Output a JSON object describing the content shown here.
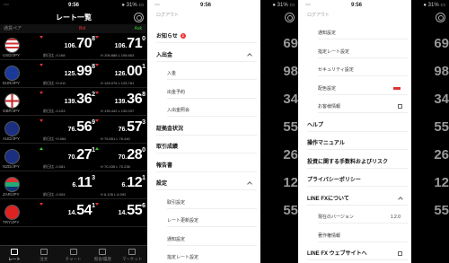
{
  "status": {
    "carrier": "⋯",
    "time": "9:56",
    "right": "● 31% ▭"
  },
  "list_screen": {
    "title": "レート一覧",
    "col_pair": "通貨ペア",
    "col_bid": "Bid",
    "col_ask": "Ask",
    "rows": [
      {
        "pair": "USD/JPY",
        "bid_prefix": "106.",
        "bid_big": "70",
        "bid_pip": "8",
        "ask_prefix": "106.",
        "ask_big": "71",
        "ask_pip": "0",
        "chg": "前日比 -0.168",
        "hl": "H 106.886 L 106.663",
        "dir": "down"
      },
      {
        "pair": "EUR/JPY",
        "bid_prefix": "125.",
        "bid_big": "99",
        "bid_pip": "8",
        "ask_prefix": "126.",
        "ask_big": "00",
        "ask_pip": "1",
        "chg": "前日比 +0.011",
        "hl": "H 126.076 L 125.781",
        "dir": "down"
      },
      {
        "pair": "GBP/JPY",
        "bid_prefix": "139.",
        "bid_big": "36",
        "bid_pip": "2",
        "ask_prefix": "139.",
        "ask_big": "36",
        "ask_pip": "8",
        "chg": "前日比 -0.103",
        "hl": "H 139.442 L 139.237",
        "dir": "down"
      },
      {
        "pair": "AUD/JPY",
        "bid_prefix": "76.",
        "bid_big": "56",
        "bid_pip": "9",
        "ask_prefix": "76.",
        "ask_big": "57",
        "ask_pip": "3",
        "chg": "前日比 +0.064",
        "hl": "H 76.651 L 76.440",
        "dir": "down"
      },
      {
        "pair": "NZD/JPY",
        "bid_prefix": "70.",
        "bid_big": "27",
        "bid_pip": "1",
        "ask_prefix": "70.",
        "ask_big": "28",
        "ask_pip": "0",
        "chg": "前日比 -0.081",
        "hl": "H 70.435 L 70.238",
        "dir": "up"
      },
      {
        "pair": "ZAR/JPY",
        "bid_prefix": "6.",
        "bid_big": "11",
        "bid_pip": "3",
        "ask_prefix": "6.",
        "ask_big": "12",
        "ask_pip": "1",
        "chg": "前日比 -0.004",
        "hl": "H 6.135 L 6.092",
        "dir": "none"
      },
      {
        "pair": "TRY/JPY",
        "bid_prefix": "14.",
        "bid_big": "54",
        "bid_pip": "1",
        "ask_prefix": "14.",
        "ask_big": "55",
        "ask_pip": "6",
        "chg": "",
        "hl": "",
        "dir": "down"
      }
    ],
    "tabs": [
      "レート",
      "注文",
      "チャート",
      "照会/履歴",
      "マーケット"
    ]
  },
  "menu1": {
    "logout": "ログアウト",
    "items": [
      {
        "label": "お知らせ",
        "badge": "1",
        "type": "b"
      },
      {
        "label": "入出金",
        "type": "b",
        "chev": true
      },
      {
        "label": "入金",
        "type": "sub"
      },
      {
        "label": "出金予約",
        "type": "sub"
      },
      {
        "label": "入出金照会",
        "type": "sub"
      },
      {
        "label": "証拠金状況",
        "type": "b"
      },
      {
        "label": "取引成績",
        "type": "b"
      },
      {
        "label": "報告書",
        "type": "b"
      },
      {
        "label": "設定",
        "type": "b",
        "chev": true
      },
      {
        "label": "取引設定",
        "type": "sub"
      },
      {
        "label": "レート更新設定",
        "type": "sub"
      },
      {
        "label": "通知設定",
        "type": "sub"
      },
      {
        "label": "指定レート設定",
        "type": "sub"
      }
    ],
    "bg_prices": [
      "69",
      "98",
      "34",
      "55",
      "26",
      "12",
      "55"
    ]
  },
  "menu2": {
    "logout": "ログアウト",
    "items": [
      {
        "label": "通知設定",
        "type": "sub"
      },
      {
        "label": "指定レート設定",
        "type": "sub"
      },
      {
        "label": "セキュリティ設定",
        "type": "sub"
      },
      {
        "label": "配色設定",
        "type": "sub",
        "red": true
      },
      {
        "label": "お客様情報",
        "type": "sub",
        "ext": true
      },
      {
        "label": "ヘルプ",
        "type": "b"
      },
      {
        "label": "操作マニュアル",
        "type": "b"
      },
      {
        "label": "投資に関する手数料およびリスク",
        "type": "b"
      },
      {
        "label": "プライバシーポリシー",
        "type": "b"
      },
      {
        "label": "LINE FXについて",
        "type": "b",
        "chev": true
      },
      {
        "label": "現在のバージョン",
        "type": "sub",
        "value": "1.2.0"
      },
      {
        "label": "著作権情報",
        "type": "sub"
      },
      {
        "label": "LINE FX ウェブサイトへ",
        "type": "b",
        "ext": true
      }
    ],
    "bg_prices": [
      "69",
      "98",
      "34",
      "55",
      "26",
      "12",
      "55"
    ]
  }
}
